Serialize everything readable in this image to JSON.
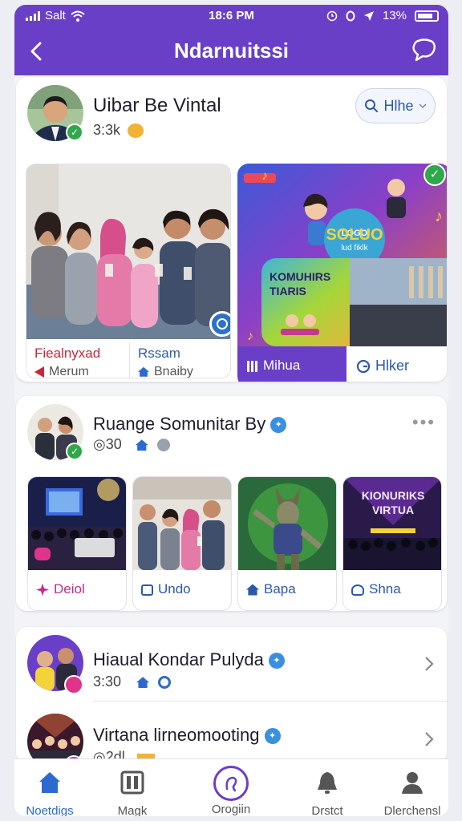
{
  "status": {
    "carrier": "Salt",
    "time": "18:6 PM",
    "battery": "13%"
  },
  "header": {
    "title": "Ndarnuitssi",
    "back_icon": "chevron-left-icon",
    "action_icon": "chat-bubble-icon"
  },
  "card1": {
    "name": "Uibar Be Vintal",
    "meta": "3:3k",
    "filter_label": "Hlhe",
    "photo_sub1_title": "Fiealnyxad",
    "photo_sub1_value": "Merum",
    "photo_sub2_title": "Rssam",
    "photo_sub2_value": "Bnaiby",
    "promo_badge": "SOLUO",
    "promo_badge_sub": "lud fiklk",
    "promo_heading": "KOMUHIRS TIARIS",
    "promo_tab1": "Mihua",
    "promo_tab2": "Hlker"
  },
  "card2": {
    "name": "Ruange Somunitar By",
    "meta": "◎30",
    "more": "•••",
    "tiles": [
      {
        "label": "Deiol"
      },
      {
        "label": "Undo"
      },
      {
        "label": "Bapa"
      },
      {
        "label": "Shna",
        "heading": "KIONURIKS VIRTUA"
      }
    ]
  },
  "card3": {
    "rows": [
      {
        "name": "Hiaual Kondar Pulyda",
        "meta": "3:30"
      },
      {
        "name": "Virtana lirneomooting",
        "meta": "◎2dl"
      }
    ]
  },
  "nav": {
    "items": [
      {
        "label": "Noetdigs"
      },
      {
        "label": "Magk"
      },
      {
        "label": "Orogiin"
      },
      {
        "label": "Drstct"
      },
      {
        "label": "Dlerchensl"
      }
    ]
  },
  "colors": {
    "brand": "#6a3fc8",
    "link": "#2c5aa8",
    "verified": "#2fa84a",
    "active": "#2d6ad0"
  }
}
